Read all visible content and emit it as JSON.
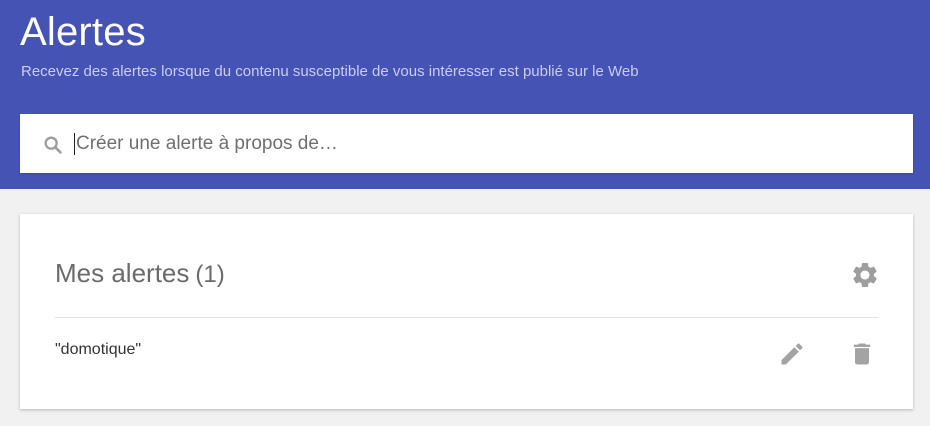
{
  "header": {
    "title": "Alertes",
    "subtitle": "Recevez des alertes lorsque du contenu susceptible de vous intéresser est publié sur le Web",
    "background_color": "#4553b5"
  },
  "search": {
    "placeholder": "Créer une alerte à propos de…",
    "value": "",
    "icon": "search-icon"
  },
  "alerts_card": {
    "title": "Mes alertes",
    "count": "(1)",
    "settings_icon": "gear-icon",
    "items": [
      {
        "label": "\"domotique\"",
        "edit_icon": "pencil-icon",
        "delete_icon": "trash-icon"
      }
    ]
  }
}
